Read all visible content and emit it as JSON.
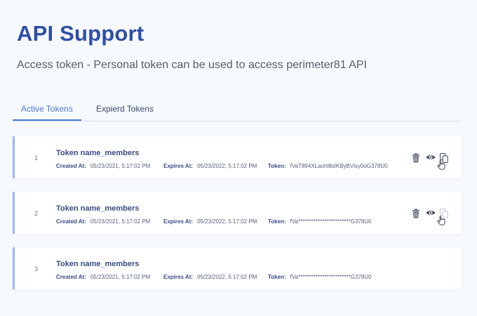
{
  "page": {
    "title": "API Support",
    "subtitle": "Access token - Personal token can be used to access perimeter81 API"
  },
  "tabs": [
    {
      "label": "Active Tokens",
      "active": true
    },
    {
      "label": "Expierd Tokens",
      "active": false
    }
  ],
  "labels": {
    "created": "Created At:",
    "expires": "Expires At:",
    "token": "Token:"
  },
  "tokens": [
    {
      "index": "1",
      "name": "Token name_members",
      "created": "05/23/2021, 5:17:02 PM",
      "expires": "05/23/2022, 5:17:02 PM",
      "token": "fVaT894XLaohl8sIKByBVisy0oG378U0",
      "actions": [
        "trash-icon",
        "eye-icon",
        "copy-icon"
      ]
    },
    {
      "index": "2",
      "name": "Token name_members",
      "created": "05/23/2021, 5:17:02 PM",
      "expires": "05/23/2022, 5:17:02 PM",
      "token": "fVa************************G378U0",
      "actions": [
        "trash-icon",
        "eye-icon",
        "copy-icon"
      ]
    },
    {
      "index": "3",
      "name": "Token name_members",
      "created": "05/23/2021, 5:17:02 PM",
      "expires": "05/23/2022, 5:17:02 PM",
      "token": "fVa************************G378U0",
      "actions": []
    }
  ],
  "colors": {
    "accent": "#4a79d8",
    "title": "#2f4ea8",
    "row_border": "#9cb3ee",
    "background": "#f6f9fd"
  }
}
